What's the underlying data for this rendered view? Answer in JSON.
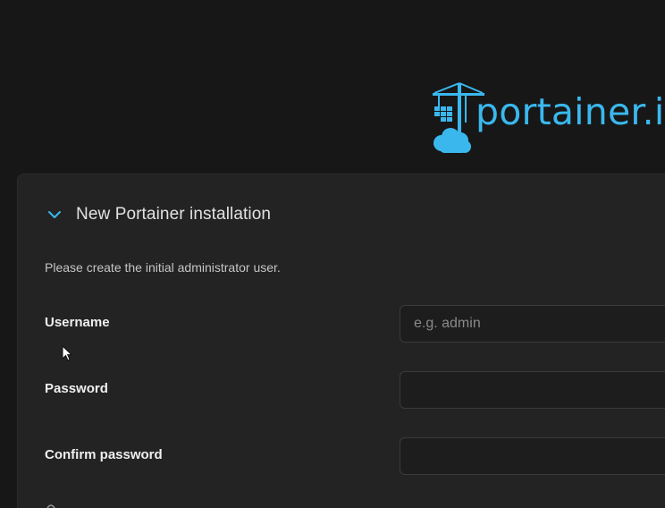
{
  "brand": {
    "logo_text": "portainer.io",
    "color": "#3ab8ee",
    "icon": "portainer-crane-icon"
  },
  "setup_card": {
    "collapse_icon": "chevron-down-icon",
    "title": "New Portainer installation",
    "intro": "Please create the initial administrator user.",
    "fields": {
      "username": {
        "label": "Username",
        "placeholder": "e.g. admin",
        "value": ""
      },
      "password": {
        "label": "Password",
        "placeholder": "",
        "value": ""
      },
      "confirm_password": {
        "label": "Confirm password",
        "placeholder": "",
        "value": ""
      }
    }
  }
}
